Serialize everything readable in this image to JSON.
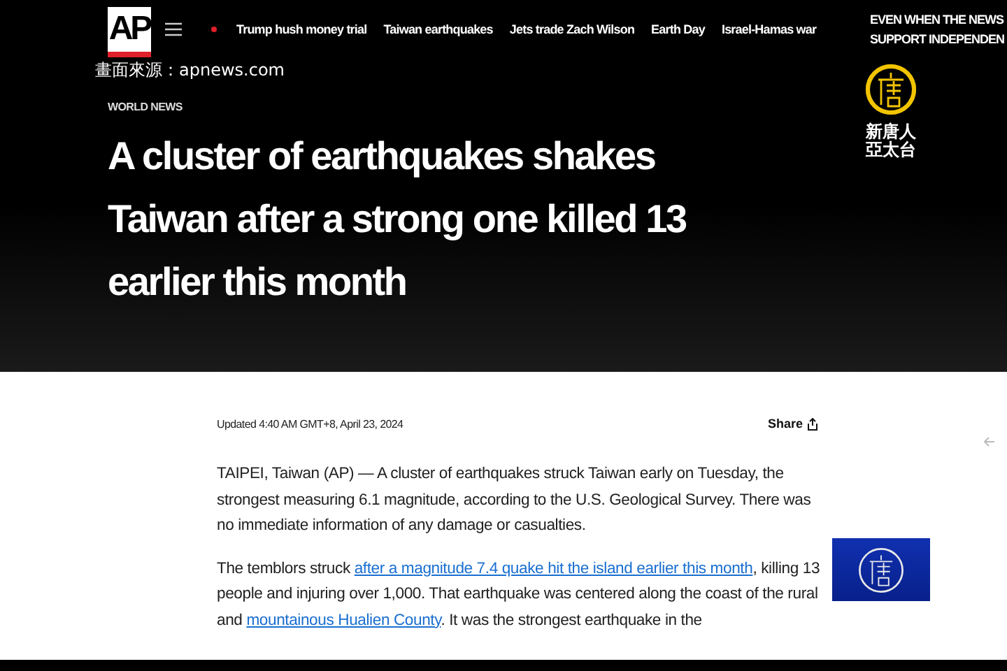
{
  "broadcast": {
    "source_caption": "畫面來源：apnews.com",
    "channel_lines": [
      "新唐人",
      "亞太台"
    ]
  },
  "site_header": {
    "logo": "AP",
    "nav": [
      "Trump hush money trial",
      "Taiwan earthquakes",
      "Jets trade Zach Wilson",
      "Earth Day",
      "Israel-Hamas war"
    ],
    "promo_lines": [
      "EVEN WHEN THE NEWS",
      "SUPPORT INDEPENDEN"
    ]
  },
  "article": {
    "section": "WORLD NEWS",
    "headline": "A cluster of earthquakes shakes Taiwan after a strong one killed 13 earlier this month",
    "updated": "Updated 4:40 AM GMT+8, April 23, 2024",
    "share": "Share",
    "paragraphs": [
      [
        {
          "text": "TAIPEI, Taiwan (AP) — A cluster of earthquakes struck Taiwan early on Tuesday, the strongest measuring 6.1 magnitude, according to the U.S. Geological Survey. There was no immediate information of any damage or casualties.",
          "link": false
        }
      ],
      [
        {
          "text": "The temblors struck ",
          "link": false
        },
        {
          "text": "after a magnitude 7.4 quake hit the island earlier this month",
          "link": true
        },
        {
          "text": ", killing 13 people and injuring over 1,000. That earthquake was centered along the coast of the rural and ",
          "link": false
        },
        {
          "text": "mountainous Hualien County",
          "link": true
        },
        {
          "text": ". It was the strongest earthquake in the",
          "link": false
        }
      ]
    ]
  }
}
